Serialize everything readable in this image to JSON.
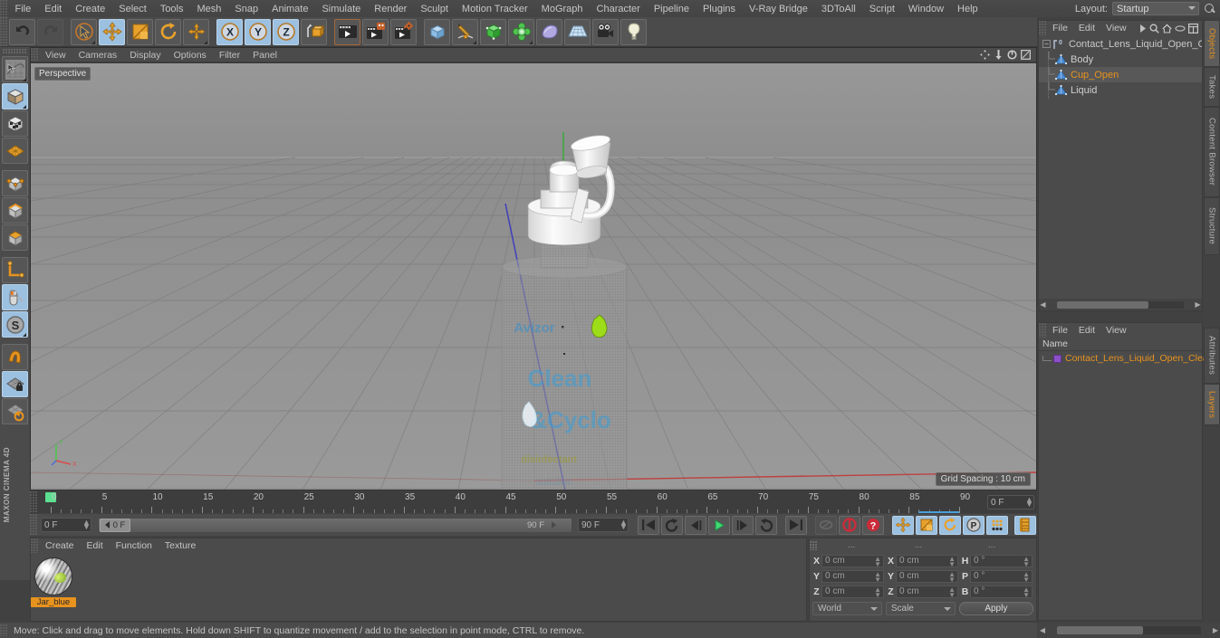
{
  "app": {
    "title": "CINEMA 4D",
    "brand": "MAXON"
  },
  "menu": {
    "items": [
      "File",
      "Edit",
      "Create",
      "Select",
      "Tools",
      "Mesh",
      "Snap",
      "Animate",
      "Simulate",
      "Render",
      "Sculpt",
      "Motion Tracker",
      "MoGraph",
      "Character",
      "Pipeline",
      "Plugins",
      "V-Ray Bridge",
      "3DToAll",
      "Script",
      "Window",
      "Help"
    ],
    "layout_label": "Layout:",
    "layout_value": "Startup",
    "search_icon": "magnifier-icon"
  },
  "toolbar": {
    "groups": [
      {
        "name": "history",
        "buttons": [
          {
            "icon": "undo-icon",
            "label": "Undo",
            "state": "normal"
          },
          {
            "icon": "redo-icon",
            "label": "Redo",
            "state": "disabled"
          }
        ]
      },
      {
        "name": "tools",
        "buttons": [
          {
            "icon": "live-selection-icon",
            "label": "Live Selection",
            "state": "normal"
          },
          {
            "icon": "move-icon",
            "label": "Move",
            "state": "active"
          },
          {
            "icon": "scale-icon",
            "label": "Scale",
            "state": "normal"
          },
          {
            "icon": "rotate-icon",
            "label": "Rotate",
            "state": "normal"
          },
          {
            "icon": "move-alt-icon",
            "label": "Move Axis",
            "state": "normal"
          }
        ]
      },
      {
        "name": "axis-locks",
        "buttons": [
          {
            "icon": "x-axis-icon",
            "label": "X Axis",
            "state": "active"
          },
          {
            "icon": "y-axis-icon",
            "label": "Y Axis",
            "state": "active"
          },
          {
            "icon": "z-axis-icon",
            "label": "Z Axis",
            "state": "active"
          },
          {
            "icon": "world-object-coordinates-icon",
            "label": "World / Object Coordinate System",
            "state": "normal"
          }
        ]
      },
      {
        "name": "render",
        "buttons": [
          {
            "icon": "render-view-icon",
            "label": "Render View",
            "state": "normal"
          },
          {
            "icon": "render-region-icon",
            "label": "Render to Picture Viewer",
            "state": "normal"
          },
          {
            "icon": "render-settings-icon",
            "label": "Edit Render Settings",
            "state": "normal"
          }
        ]
      },
      {
        "name": "create",
        "buttons": [
          {
            "icon": "cube-primitive-icon",
            "label": "Add Cube Object",
            "state": "normal"
          },
          {
            "icon": "spline-pen-icon",
            "label": "Add Spline",
            "state": "normal"
          },
          {
            "icon": "generator-icon",
            "label": "Add Generator",
            "state": "normal"
          },
          {
            "icon": "deformer-icon",
            "label": "Add Deformer",
            "state": "normal"
          },
          {
            "icon": "environment-icon",
            "label": "Add Scene Object",
            "state": "normal"
          },
          {
            "icon": "floor-icon",
            "label": "Add Floor",
            "state": "normal"
          },
          {
            "icon": "camera-icon",
            "label": "Add Camera",
            "state": "normal"
          },
          {
            "icon": "light-icon",
            "label": "Add Light",
            "state": "normal"
          }
        ]
      }
    ]
  },
  "left_toolbar": {
    "buttons": [
      {
        "icon": "selection-tools-icon",
        "label": "Selection Tools",
        "state": "normal"
      },
      {
        "icon": "model-mode-icon",
        "label": "Model Mode",
        "state": "active"
      },
      {
        "icon": "texture-mode-icon",
        "label": "Texture Mode",
        "state": "normal"
      },
      {
        "icon": "workplane-mode-icon",
        "label": "Workplane Mode",
        "state": "normal"
      },
      {
        "icon": "point-mode-icon",
        "label": "Points Mode",
        "state": "normal"
      },
      {
        "icon": "edge-mode-icon",
        "label": "Edges Mode",
        "state": "normal"
      },
      {
        "icon": "polygon-mode-icon",
        "label": "Polygons Mode",
        "state": "normal"
      },
      {
        "icon": "axis-modify-icon",
        "label": "Enable Axis Modification",
        "state": "normal"
      },
      {
        "icon": "viewport-solo-icon",
        "label": "Viewport Solo Single",
        "state": "active"
      },
      {
        "icon": "soft-selection-icon",
        "label": "Enable Soft Interaction",
        "state": "active"
      },
      {
        "icon": "magnet-icon",
        "label": "Magnet",
        "state": "normal"
      },
      {
        "icon": "workplane-lock-icon",
        "label": "Lock Workplane",
        "state": "active"
      },
      {
        "icon": "workplane-align-icon",
        "label": "Planar Workplane",
        "state": "normal"
      }
    ]
  },
  "viewport": {
    "menu": [
      "View",
      "Cameras",
      "Display",
      "Options",
      "Filter",
      "Panel"
    ],
    "corner_icons": [
      "pan-icon",
      "zoom-icon",
      "rotate-icon",
      "maximize-icon"
    ],
    "camera_tag": "Perspective",
    "grid_spacing": "Grid Spacing : 10 cm",
    "axis_labels": {
      "y": "Y",
      "x": "X"
    },
    "scene_objects": [
      "bottle-body",
      "cap",
      "flip-lid"
    ],
    "bottle_label_lines": [
      "Avizor",
      "Clean",
      "&Cyclo",
      "disinfectant",
      "solution"
    ]
  },
  "timeline": {
    "ticks_major": [
      0,
      5,
      10,
      15,
      20,
      25,
      30,
      35,
      40,
      45,
      50,
      55,
      60,
      65,
      70,
      75,
      80,
      85,
      90
    ],
    "start_frame": "0 F",
    "end_frame": "90 F",
    "current_frame_right": "0 F",
    "current_frame_left": "0 F",
    "slider_value": "0 F",
    "slider_end": "90 F",
    "preview_end": "90 F"
  },
  "playback": {
    "buttons": [
      {
        "icon": "go-to-start-icon",
        "label": "Go To Start",
        "state": "normal"
      },
      {
        "icon": "previous-key-icon",
        "label": "Go To Previous Key",
        "state": "normal"
      },
      {
        "icon": "previous-frame-icon",
        "label": "Go To Previous Frame",
        "state": "normal"
      },
      {
        "icon": "play-icon",
        "label": "Play Forwards",
        "state": "normal"
      },
      {
        "icon": "next-frame-icon",
        "label": "Go To Next Frame",
        "state": "normal"
      },
      {
        "icon": "next-key-icon",
        "label": "Go To Next Key",
        "state": "normal"
      },
      {
        "icon": "go-to-end-icon",
        "label": "Go To End",
        "state": "normal"
      },
      {
        "icon": "autokey-link-icon",
        "label": "Auto Keyframing Link",
        "state": "disabled"
      },
      {
        "icon": "record-active-objects-icon",
        "label": "Record Active Objects",
        "state": "normal"
      },
      {
        "icon": "autokeying-icon",
        "label": "Autokeying",
        "state": "normal"
      },
      {
        "icon": "key-position-icon",
        "label": "Position",
        "state": "active"
      },
      {
        "icon": "key-scale-icon",
        "label": "Scale",
        "state": "active"
      },
      {
        "icon": "key-rotation-icon",
        "label": "Rotation",
        "state": "active"
      },
      {
        "icon": "key-parameter-icon",
        "label": "Parameter",
        "state": "active"
      },
      {
        "icon": "key-pla-icon",
        "label": "Point Level Animation",
        "state": "active"
      },
      {
        "icon": "dope-sheet-icon",
        "label": "Timeline",
        "state": "active"
      }
    ]
  },
  "material_manager": {
    "menu": [
      "Create",
      "Edit",
      "Function",
      "Texture"
    ],
    "materials": [
      {
        "name": "Jar_blue",
        "selected": true,
        "preview": "material-sphere-preview"
      }
    ]
  },
  "coordinates": {
    "headers": [
      "...",
      "...",
      "..."
    ],
    "rows": [
      {
        "axis1": "X",
        "value1": "0 cm",
        "axis2": "X",
        "value2": "0 cm",
        "axis3": "H",
        "value3": "0 °"
      },
      {
        "axis1": "Y",
        "value1": "0 cm",
        "axis2": "Y",
        "value2": "0 cm",
        "axis3": "P",
        "value3": "0 °"
      },
      {
        "axis1": "Z",
        "value1": "0 cm",
        "axis2": "Z",
        "value2": "0 cm",
        "axis3": "B",
        "value3": "0 °"
      }
    ],
    "system": "World",
    "mode": "Scale",
    "apply_label": "Apply"
  },
  "object_manager": {
    "menu": [
      "File",
      "Edit",
      "View"
    ],
    "icons": [
      "play-arrow-icon",
      "magnifier-icon",
      "home-icon",
      "ellipse-icon",
      "layout-icon"
    ],
    "tree": [
      {
        "name": "Contact_Lens_Liquid_Open_Clear_F",
        "depth": 0,
        "icon": "null-object-icon",
        "selected": false,
        "level_badge": "0"
      },
      {
        "name": "Body",
        "depth": 1,
        "icon": "polygon-object-icon",
        "selected": false
      },
      {
        "name": "Cup_Open",
        "depth": 1,
        "icon": "polygon-object-icon",
        "selected": true
      },
      {
        "name": "Liquid",
        "depth": 1,
        "icon": "polygon-object-icon",
        "selected": false
      }
    ]
  },
  "layer_manager": {
    "menu": [
      "File",
      "Edit",
      "View"
    ],
    "column_header": "Name",
    "rows": [
      {
        "name": "Contact_Lens_Liquid_Open_Clear_",
        "color": "#8b4fc8"
      }
    ]
  },
  "right_tabs": [
    {
      "label": "Objects",
      "active": true
    },
    {
      "label": "Takes",
      "active": false
    },
    {
      "label": "Content Browser",
      "active": false
    },
    {
      "label": "Structure",
      "active": false
    },
    {
      "label": "Attributes",
      "active": false
    },
    {
      "label": "Layers",
      "active": true
    }
  ],
  "status_bar": {
    "message": "Move: Click and drag to move elements. Hold down SHIFT to quantize movement / add to the selection in point mode, CTRL to remove."
  },
  "colors": {
    "accent_orange": "#e8931e",
    "active_blue": "#9cc0e0",
    "panel_bg": "#4b4b4b",
    "viewport_bg": "#8f8f8f",
    "playhead_green": "#5ce08f",
    "layer_purple": "#8b4fc8",
    "axis_x_red": "#cc4444",
    "axis_y_green": "#44aa44",
    "axis_z_blue": "#4444cc"
  }
}
